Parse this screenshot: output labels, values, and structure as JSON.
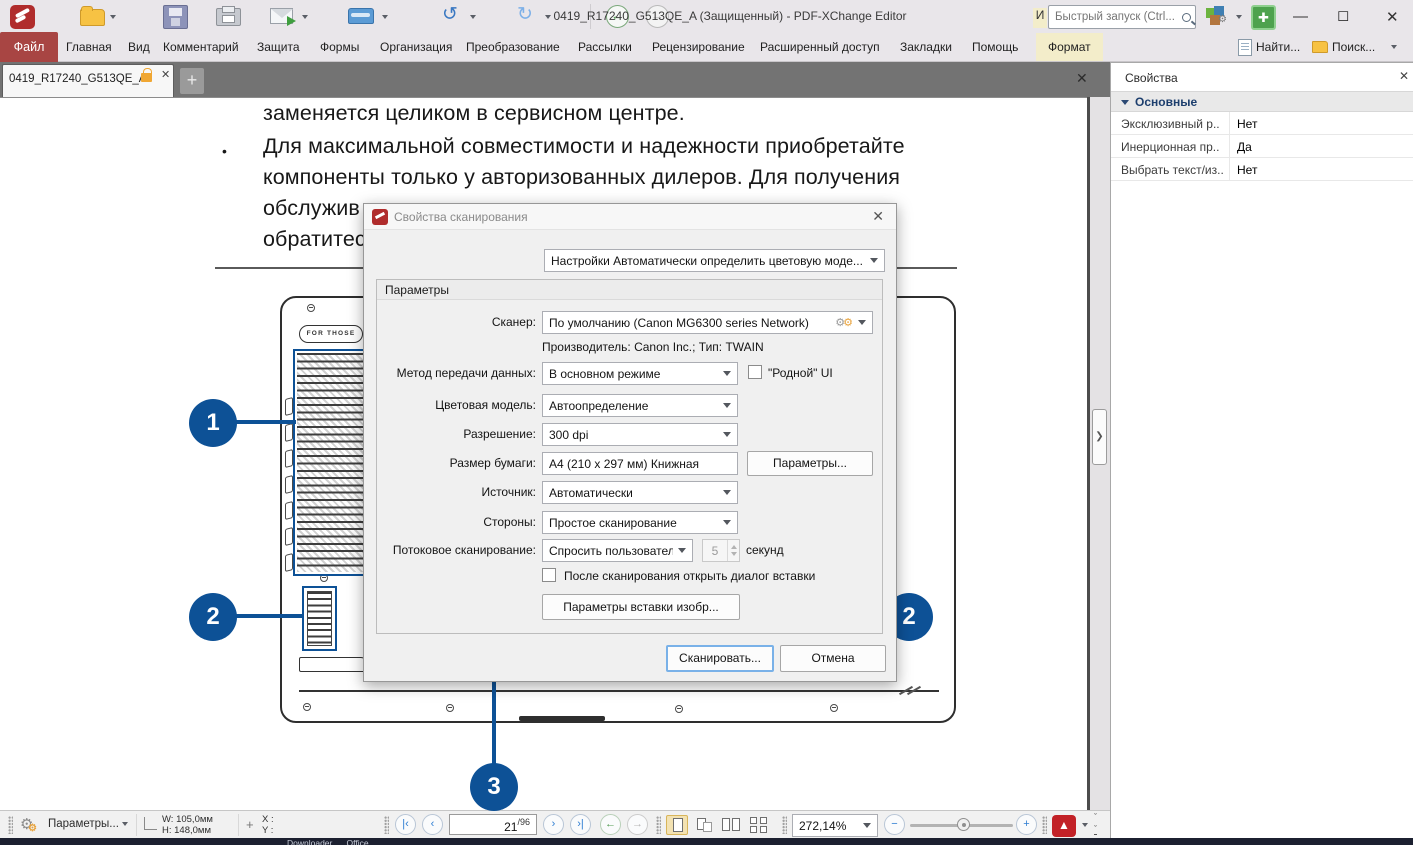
{
  "titlebar": {
    "title": "0419_R17240_G513QE_A (Защищенный) - PDF-XChange Editor",
    "partial_label": "И",
    "quick_launch_placeholder": "Быстрый запуск (Ctrl...",
    "minimize": "—",
    "maximize": "◻",
    "close": "✕"
  },
  "menubar": {
    "file": "Файл",
    "items": [
      "Главная",
      "Вид",
      "Комментарий",
      "Защита",
      "Формы",
      "Организация",
      "Преобразование",
      "Рассылки",
      "Рецензирование",
      "Расширенный доступ",
      "Закладки",
      "Помощь"
    ],
    "format_item": "Формат",
    "find": "Найти...",
    "search": "Поиск..."
  },
  "tabbar": {
    "active_tab": "0419_R17240_G513QE_A",
    "close": "✕",
    "new_tab": "+"
  },
  "document": {
    "paragraph_top": "заменяется целиком в сервисном центре.",
    "bullet_char": "•",
    "bullet_line1": "Для максимальной совместимости и надежности приобретайте",
    "bullet_line2": "компоненты только у авторизованных дилеров. Для получения",
    "bullet_line3_partial": "обслужив",
    "bullet_line4_partial": "обратитес",
    "device_text": "FOR THOSE",
    "callouts": {
      "one": "1",
      "two_left": "2",
      "two_right": "2",
      "three": "3"
    }
  },
  "dialog": {
    "title": "Свойства сканирования",
    "close": "✕",
    "preset_label": "Настройки  Автоматически определить цветовую моде...",
    "group_title": "Параметры",
    "fields": [
      {
        "label": "Сканер:",
        "value": "По умолчанию (Canon MG6300 series Network)"
      },
      {
        "label": "Метод передачи данных:",
        "value": "В основном режиме"
      },
      {
        "label": "Цветовая модель:",
        "value": "Автоопределение"
      },
      {
        "label": "Разрешение:",
        "value": "300 dpi"
      },
      {
        "label": "Размер бумаги:",
        "value": "A4 (210 x 297 мм) Книжная"
      },
      {
        "label": "Источник:",
        "value": "Автоматически"
      },
      {
        "label": "Стороны:",
        "value": "Простое сканирование"
      },
      {
        "label": "Потоковое сканирование:",
        "value": "Спросить пользователя"
      }
    ],
    "manufacturer_info": "Производитель: Canon Inc.; Тип: TWAIN",
    "native_ui_checkbox": "\"Родной\" UI",
    "seconds_value": "5",
    "seconds_label": "секунд",
    "after_scan_checkbox": "После сканирования открыть диалог вставки",
    "paper_params_button": "Параметры...",
    "insert_params_button": "Параметры вставки изобр...",
    "scan_button": "Сканировать...",
    "cancel_button": "Отмена"
  },
  "properties_panel": {
    "title": "Свойства",
    "close": "✕",
    "section": "Основные",
    "rows": [
      {
        "label": "Эксклюзивный р..",
        "value": "Нет"
      },
      {
        "label": "Инерционная пр..",
        "value": "Да"
      },
      {
        "label": "Выбрать текст/из..",
        "value": "Нет"
      }
    ]
  },
  "statusbar": {
    "options": "Параметры...",
    "w_label": "W: 105,0мм",
    "h_label": "H: 148,0мм",
    "x_label": "X :",
    "y_label": "Y :",
    "page_current": "21",
    "page_total": "/96",
    "zoom_value": "272,14%"
  },
  "taskbar_strip": {
    "text": "Downloader      Office"
  },
  "colors": {
    "callout_blue": "#0d5196",
    "file_red": "#a84543",
    "adobe_red": "#c22127",
    "accent_amber": "#f0a733"
  }
}
